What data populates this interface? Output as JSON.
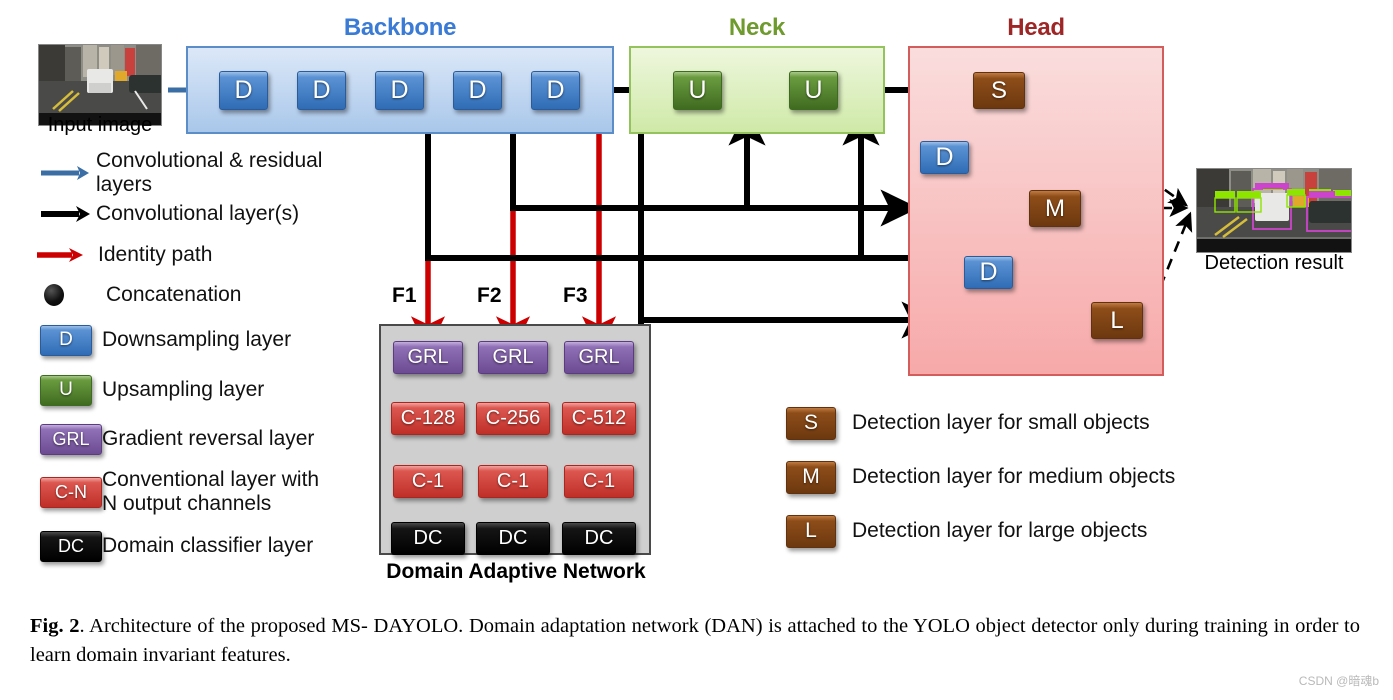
{
  "figure": {
    "groups": [
      {
        "key": "backbone",
        "title": "Backbone",
        "color": "#3a7bd5"
      },
      {
        "key": "neck",
        "title": "Neck",
        "color": "#6f9b2e"
      },
      {
        "key": "head",
        "title": "Head",
        "color": "#9e2626"
      }
    ],
    "backbone": {
      "blocks": [
        {
          "label": "D"
        },
        {
          "label": "D"
        },
        {
          "label": "D"
        },
        {
          "label": "D"
        },
        {
          "label": "D"
        }
      ]
    },
    "neck": {
      "blocks": [
        {
          "label": "U"
        },
        {
          "label": "U"
        }
      ]
    },
    "head": {
      "blocks": [
        {
          "label": "S",
          "type": "detection"
        },
        {
          "label": "D",
          "type": "downsample"
        },
        {
          "label": "M",
          "type": "detection"
        },
        {
          "label": "D",
          "type": "downsample"
        },
        {
          "label": "L",
          "type": "detection"
        }
      ]
    },
    "feature_labels": [
      "F1",
      "F2",
      "F3"
    ],
    "dan": {
      "title": "Domain Adaptive Network",
      "columns": [
        {
          "grl": "GRL",
          "conv": "C-128",
          "conv1": "C-1",
          "dc": "DC"
        },
        {
          "grl": "GRL",
          "conv": "C-256",
          "conv1": "C-1",
          "dc": "DC"
        },
        {
          "grl": "GRL",
          "conv": "C-512",
          "conv1": "C-1",
          "dc": "DC"
        }
      ]
    },
    "images": {
      "input_caption": "Input image",
      "result_caption": "Detection result"
    },
    "legend_left": [
      {
        "kind": "arrow",
        "color": "#3a6ea5",
        "label": "Convolutional & residual layers"
      },
      {
        "kind": "arrow",
        "color": "#000000",
        "label": "Convolutional layer(s)"
      },
      {
        "kind": "arrow",
        "color": "#cc0000",
        "label": "Identity path"
      },
      {
        "kind": "dot",
        "color": "#000000",
        "label": "Concatenation"
      },
      {
        "kind": "chip",
        "chip": "D",
        "style": "n-d",
        "label": "Downsampling layer"
      },
      {
        "kind": "chip",
        "chip": "U",
        "style": "n-u",
        "label": "Upsampling layer"
      },
      {
        "kind": "chip",
        "chip": "GRL",
        "style": "n-grl",
        "label": "Gradient reversal layer"
      },
      {
        "kind": "chip",
        "chip": "C-N",
        "style": "n-c",
        "label": "Conventional layer with\nN output channels"
      },
      {
        "kind": "chip",
        "chip": "DC",
        "style": "n-dc",
        "label": "Domain classifier layer"
      }
    ],
    "legend_right": [
      {
        "chip": "S",
        "label": "Detection layer for small objects"
      },
      {
        "chip": "M",
        "label": "Detection layer for medium objects"
      },
      {
        "chip": "L",
        "label": "Detection layer for large objects"
      }
    ],
    "caption": {
      "prefix": "Fig. 2",
      "text": ".  Architecture of the proposed MS- DAYOLO. Domain adaptation network (DAN) is attached to the YOLO object detector only during training in order to learn domain invariant features."
    },
    "watermark": "CSDN @暗魂b",
    "colors": {
      "backbone_fill": "#a9c7ea",
      "neck_fill": "#cfe9a8",
      "head_fill": "#f7a9a9",
      "identity_red": "#cc0000",
      "conv_black": "#000000",
      "residual_blue": "#3a6ea5",
      "grl_purple": "#6c4b92",
      "conv_red": "#bf2f28",
      "dc_black": "#000000",
      "detect_brown": "#8d4d19"
    }
  }
}
